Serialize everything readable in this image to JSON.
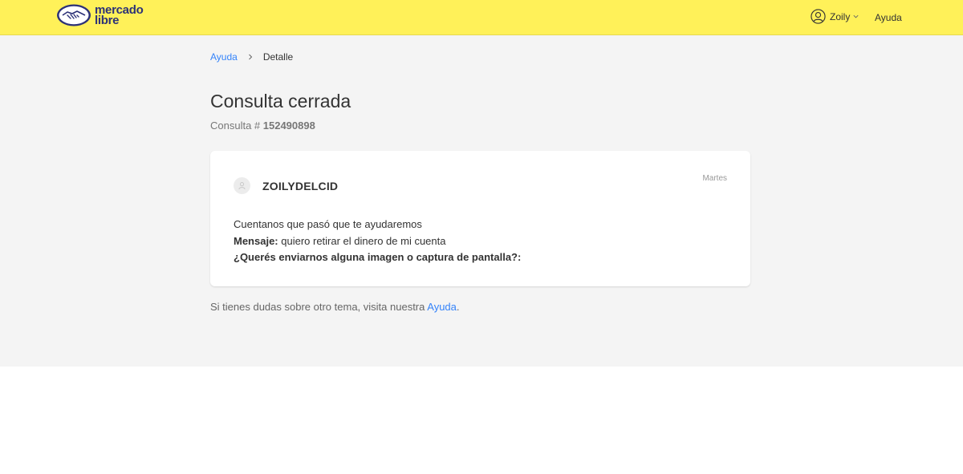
{
  "header": {
    "logo_line1": "mercado",
    "logo_line2": "libre",
    "user_name": "Zoily",
    "help_label": "Ayuda",
    "brand_color": "#fff159"
  },
  "breadcrumb": {
    "root": "Ayuda",
    "current": "Detalle"
  },
  "page": {
    "title": "Consulta cerrada",
    "subtitle_prefix": "Consulta # ",
    "query_number": "152490898"
  },
  "card": {
    "username": "ZOILYDELCID",
    "date": "Martes",
    "line1": "Cuentanos que pasó que te ayudaremos",
    "message_label": "Mensaje:",
    "message_text": " quiero retirar el dinero de mi cuenta",
    "image_question": "¿Querés enviarnos alguna imagen o captura de pantalla?:"
  },
  "footer": {
    "text": "Si tienes dudas sobre otro tema, visita nuestra ",
    "link": "Ayuda",
    "end": "."
  }
}
